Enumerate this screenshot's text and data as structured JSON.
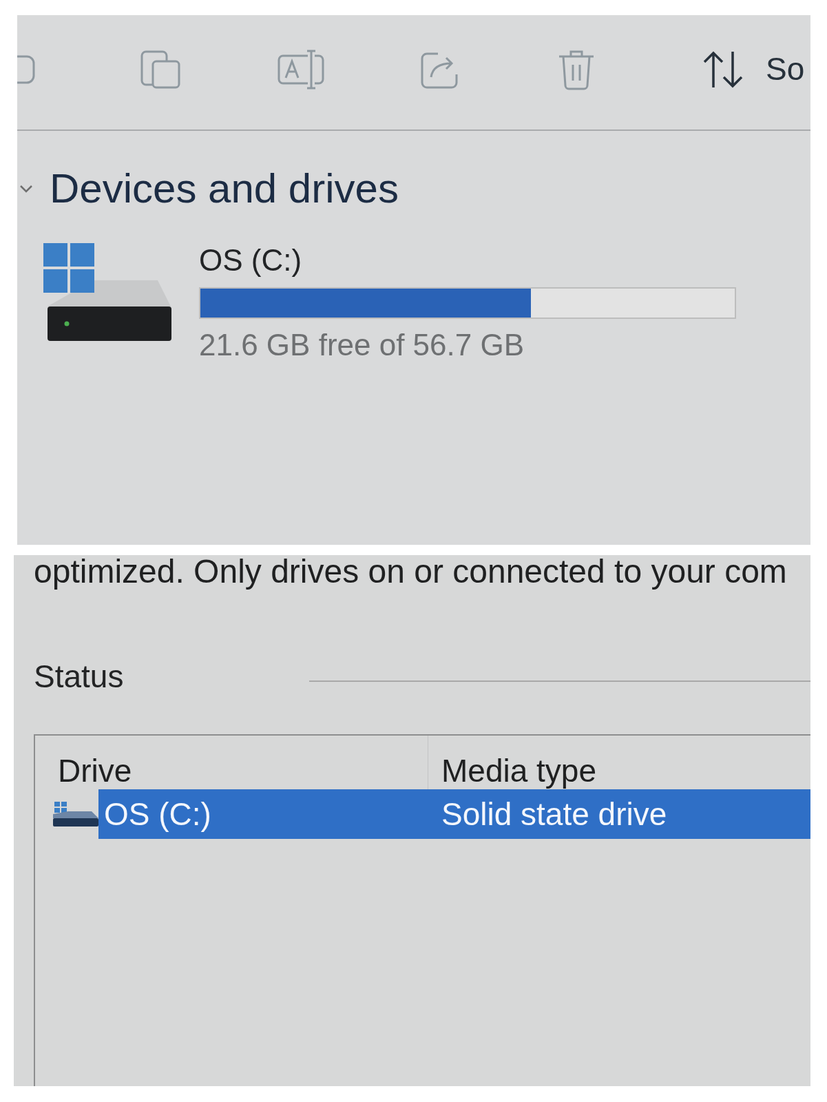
{
  "toolbar": {
    "buttons": [
      {
        "kind": "cut_off",
        "disabled": true
      },
      {
        "kind": "copy",
        "disabled": true
      },
      {
        "kind": "rename",
        "disabled": true
      },
      {
        "kind": "share",
        "disabled": true
      },
      {
        "kind": "delete",
        "disabled": true
      },
      {
        "kind": "sort",
        "disabled": false,
        "label": "So"
      }
    ]
  },
  "devices_section": {
    "title": "Devices and drives",
    "expanded": true,
    "drives": [
      {
        "name": "OS (C:)",
        "level": 0.619,
        "space": "21.6 GB free of 56.7 GB"
      }
    ]
  },
  "optimize_panel": {
    "description": "optimized. Only drives on or connected to your com",
    "status_label": "Status",
    "table": {
      "columns": [
        "Drive",
        "Media type"
      ],
      "rows": [
        {
          "cells": [
            "OS (C:)",
            "Solid state drive"
          ],
          "selected": true
        }
      ]
    }
  }
}
